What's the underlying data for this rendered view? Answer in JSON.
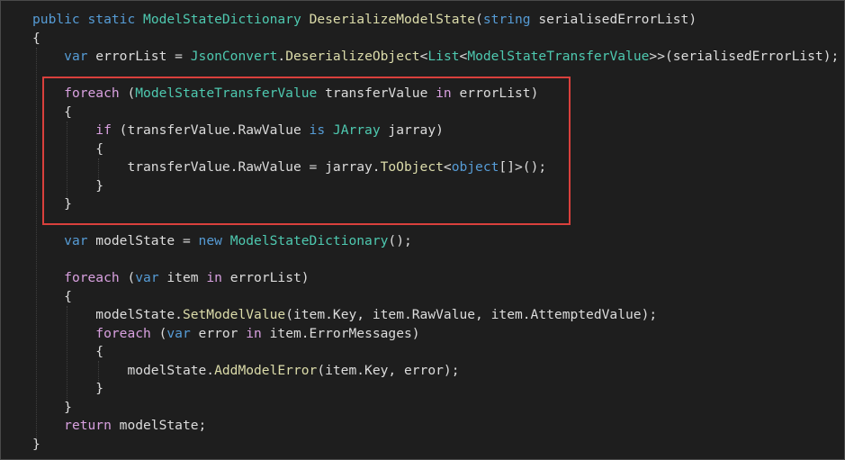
{
  "colors": {
    "background": "#1e1e1e",
    "keyword": "#569cd6",
    "control_keyword": "#d8a0df",
    "type": "#4ec9b0",
    "method": "#dcdcaa",
    "text": "#dcdcdc",
    "highlight_border": "#d9403c"
  },
  "code": {
    "lines": [
      {
        "indent": "",
        "tokens": [
          {
            "c": "kw",
            "t": "public"
          },
          {
            "c": "plain",
            "t": " "
          },
          {
            "c": "kw",
            "t": "static"
          },
          {
            "c": "plain",
            "t": " "
          },
          {
            "c": "type",
            "t": "ModelStateDictionary"
          },
          {
            "c": "plain",
            "t": " "
          },
          {
            "c": "meth",
            "t": "DeserializeModelState"
          },
          {
            "c": "plain",
            "t": "("
          },
          {
            "c": "kw",
            "t": "string"
          },
          {
            "c": "plain",
            "t": " serialisedErrorList)"
          }
        ]
      },
      {
        "indent": "",
        "tokens": [
          {
            "c": "plain",
            "t": "{"
          }
        ]
      },
      {
        "indent": "    ",
        "tokens": [
          {
            "c": "kw",
            "t": "var"
          },
          {
            "c": "plain",
            "t": " errorList = "
          },
          {
            "c": "type",
            "t": "JsonConvert"
          },
          {
            "c": "plain",
            "t": "."
          },
          {
            "c": "meth",
            "t": "DeserializeObject"
          },
          {
            "c": "plain",
            "t": "<"
          },
          {
            "c": "type",
            "t": "List"
          },
          {
            "c": "plain",
            "t": "<"
          },
          {
            "c": "type",
            "t": "ModelStateTransferValue"
          },
          {
            "c": "plain",
            "t": ">>(serialisedErrorList);"
          }
        ]
      },
      {
        "indent": "",
        "tokens": []
      },
      {
        "indent": "    ",
        "tokens": [
          {
            "c": "ctl",
            "t": "foreach"
          },
          {
            "c": "plain",
            "t": " ("
          },
          {
            "c": "type",
            "t": "ModelStateTransferValue"
          },
          {
            "c": "plain",
            "t": " transferValue "
          },
          {
            "c": "ctl",
            "t": "in"
          },
          {
            "c": "plain",
            "t": " errorList)"
          }
        ]
      },
      {
        "indent": "    ",
        "tokens": [
          {
            "c": "plain",
            "t": "{"
          }
        ]
      },
      {
        "indent": "        ",
        "tokens": [
          {
            "c": "ctl",
            "t": "if"
          },
          {
            "c": "plain",
            "t": " (transferValue.RawValue "
          },
          {
            "c": "kw",
            "t": "is"
          },
          {
            "c": "plain",
            "t": " "
          },
          {
            "c": "type",
            "t": "JArray"
          },
          {
            "c": "plain",
            "t": " jarray)"
          }
        ]
      },
      {
        "indent": "        ",
        "tokens": [
          {
            "c": "plain",
            "t": "{"
          }
        ]
      },
      {
        "indent": "            ",
        "tokens": [
          {
            "c": "plain",
            "t": "transferValue.RawValue = jarray."
          },
          {
            "c": "meth",
            "t": "ToObject"
          },
          {
            "c": "plain",
            "t": "<"
          },
          {
            "c": "kw",
            "t": "object"
          },
          {
            "c": "plain",
            "t": "[]>();"
          }
        ]
      },
      {
        "indent": "        ",
        "tokens": [
          {
            "c": "plain",
            "t": "}"
          }
        ]
      },
      {
        "indent": "    ",
        "tokens": [
          {
            "c": "plain",
            "t": "}"
          }
        ]
      },
      {
        "indent": "",
        "tokens": []
      },
      {
        "indent": "    ",
        "tokens": [
          {
            "c": "kw",
            "t": "var"
          },
          {
            "c": "plain",
            "t": " modelState = "
          },
          {
            "c": "kw",
            "t": "new"
          },
          {
            "c": "plain",
            "t": " "
          },
          {
            "c": "type",
            "t": "ModelStateDictionary"
          },
          {
            "c": "plain",
            "t": "();"
          }
        ]
      },
      {
        "indent": "",
        "tokens": []
      },
      {
        "indent": "    ",
        "tokens": [
          {
            "c": "ctl",
            "t": "foreach"
          },
          {
            "c": "plain",
            "t": " ("
          },
          {
            "c": "kw",
            "t": "var"
          },
          {
            "c": "plain",
            "t": " item "
          },
          {
            "c": "ctl",
            "t": "in"
          },
          {
            "c": "plain",
            "t": " errorList)"
          }
        ]
      },
      {
        "indent": "    ",
        "tokens": [
          {
            "c": "plain",
            "t": "{"
          }
        ]
      },
      {
        "indent": "        ",
        "tokens": [
          {
            "c": "plain",
            "t": "modelState."
          },
          {
            "c": "meth",
            "t": "SetModelValue"
          },
          {
            "c": "plain",
            "t": "(item.Key, item.RawValue, item.AttemptedValue);"
          }
        ]
      },
      {
        "indent": "        ",
        "tokens": [
          {
            "c": "ctl",
            "t": "foreach"
          },
          {
            "c": "plain",
            "t": " ("
          },
          {
            "c": "kw",
            "t": "var"
          },
          {
            "c": "plain",
            "t": " error "
          },
          {
            "c": "ctl",
            "t": "in"
          },
          {
            "c": "plain",
            "t": " item.ErrorMessages)"
          }
        ]
      },
      {
        "indent": "        ",
        "tokens": [
          {
            "c": "plain",
            "t": "{"
          }
        ]
      },
      {
        "indent": "            ",
        "tokens": [
          {
            "c": "plain",
            "t": "modelState."
          },
          {
            "c": "meth",
            "t": "AddModelError"
          },
          {
            "c": "plain",
            "t": "(item.Key, error);"
          }
        ]
      },
      {
        "indent": "        ",
        "tokens": [
          {
            "c": "plain",
            "t": "}"
          }
        ]
      },
      {
        "indent": "    ",
        "tokens": [
          {
            "c": "plain",
            "t": "}"
          }
        ]
      },
      {
        "indent": "    ",
        "tokens": [
          {
            "c": "ctl",
            "t": "return"
          },
          {
            "c": "plain",
            "t": " modelState;"
          }
        ]
      },
      {
        "indent": "",
        "tokens": [
          {
            "c": "plain",
            "t": "}"
          }
        ]
      }
    ]
  }
}
